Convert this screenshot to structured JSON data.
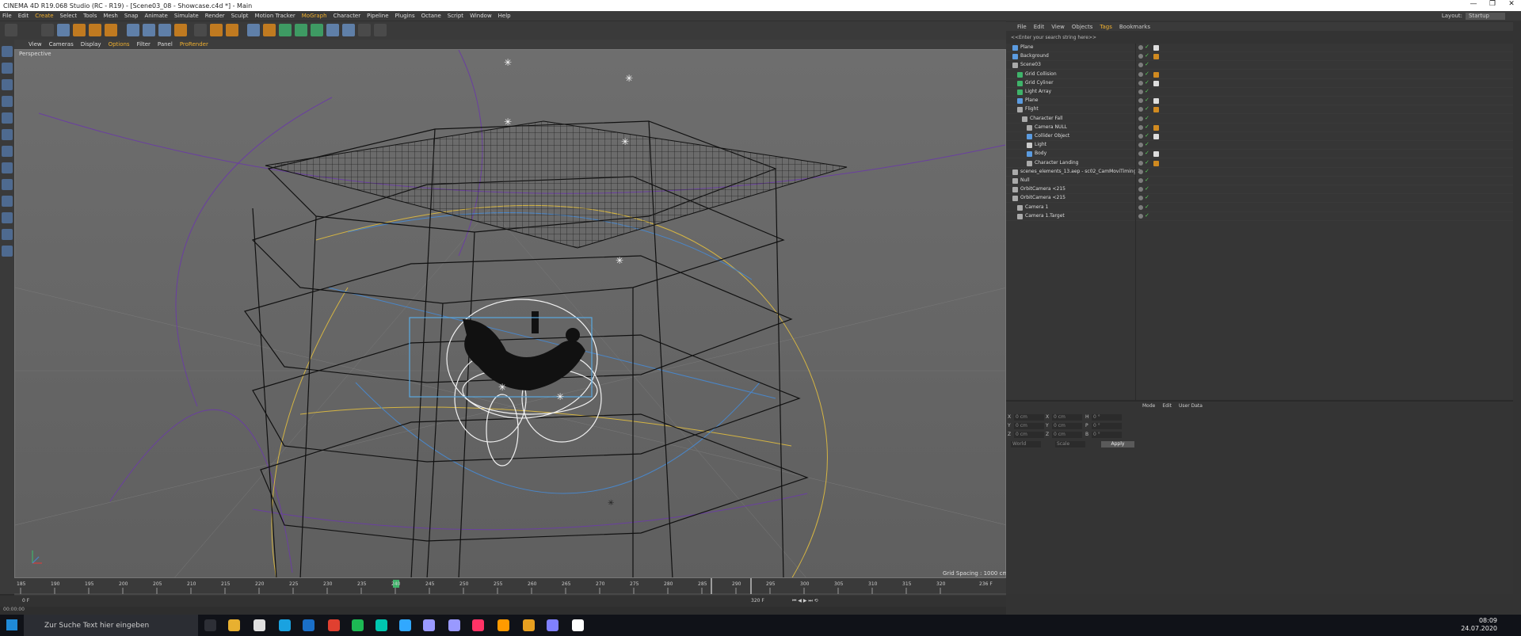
{
  "window": {
    "title": "CINEMA 4D R19.068 Studio (RC - R19) - [Scene03_08 - Showcase.c4d *] - Main",
    "controls": [
      "—",
      "❐",
      "✕"
    ]
  },
  "menu": [
    "File",
    "Edit",
    "Create",
    "Select",
    "Tools",
    "Mesh",
    "Snap",
    "Animate",
    "Simulate",
    "Render",
    "Sculpt",
    "Motion Tracker",
    "MoGraph",
    "Character",
    "Pipeline",
    "Plugins",
    "Octane",
    "Script",
    "Window",
    "Help"
  ],
  "layout": {
    "label": "Layout:",
    "value": "Startup"
  },
  "viewport": {
    "menu": [
      "View",
      "Cameras",
      "Display",
      "Options",
      "Filter",
      "Panel",
      "ProRender"
    ],
    "label": "Perspective",
    "grid_spacing": "Grid Spacing : 1000 cm"
  },
  "timeline": {
    "ticks": [
      "185",
      "190",
      "195",
      "200",
      "205",
      "210",
      "215",
      "220",
      "225",
      "230",
      "235",
      "240",
      "245",
      "250",
      "255",
      "260",
      "265",
      "270",
      "275",
      "280",
      "285",
      "290",
      "295",
      "300",
      "305",
      "310",
      "315",
      "320"
    ],
    "current": "236",
    "end_field": "236 F",
    "start_field": "0 F",
    "range_field": "320 F",
    "range_end": "320 F"
  },
  "status": {
    "time": "00:00:00"
  },
  "objects": {
    "menu": [
      "File",
      "Edit",
      "View",
      "Objects",
      "Tags",
      "Bookmarks"
    ],
    "search_placeholder": "<<Enter your search string here>>",
    "rows": [
      {
        "name": "Plane",
        "depth": 0,
        "color": "#5b9be0"
      },
      {
        "name": "Background",
        "depth": 0,
        "color": "#5b9be0"
      },
      {
        "name": "Scene03",
        "depth": 0,
        "color": "#aaaaaa"
      },
      {
        "name": "Grid Collision",
        "depth": 1,
        "color": "#3fb36a"
      },
      {
        "name": "Grid Cyliner",
        "depth": 1,
        "color": "#3fb36a"
      },
      {
        "name": "Light Array",
        "depth": 1,
        "color": "#3fb36a"
      },
      {
        "name": "Plane",
        "depth": 1,
        "color": "#5b9be0"
      },
      {
        "name": "Flight",
        "depth": 1,
        "color": "#aaaaaa"
      },
      {
        "name": "Character Fall",
        "depth": 2,
        "color": "#aaaaaa"
      },
      {
        "name": "Camera NULL",
        "depth": 3,
        "color": "#aaaaaa"
      },
      {
        "name": "Collider Object",
        "depth": 3,
        "color": "#5b9be0"
      },
      {
        "name": "Light",
        "depth": 3,
        "color": "#cccccc"
      },
      {
        "name": "Body",
        "depth": 3,
        "color": "#5b9be0"
      },
      {
        "name": "Character Landing",
        "depth": 3,
        "color": "#aaaaaa"
      },
      {
        "name": "scenes_elements_13.aep - sc02_CamMoviTiming 2",
        "depth": 0,
        "color": "#aaaaaa"
      },
      {
        "name": "Null",
        "depth": 0,
        "color": "#aaaaaa"
      },
      {
        "name": "OrbitCamera <215",
        "depth": 0,
        "color": "#aaaaaa"
      },
      {
        "name": "OrbitCamera <215",
        "depth": 0,
        "color": "#aaaaaa"
      },
      {
        "name": "Camera 1",
        "depth": 1,
        "color": "#aaaaaa"
      },
      {
        "name": "Camera 1.Target",
        "depth": 1,
        "color": "#aaaaaa"
      }
    ]
  },
  "coordinates": {
    "rows": [
      {
        "a": "X",
        "av": "0 cm",
        "b": "X",
        "bv": "0 cm",
        "c": "H",
        "cv": "0 °"
      },
      {
        "a": "Y",
        "av": "0 cm",
        "b": "Y",
        "bv": "0 cm",
        "c": "P",
        "cv": "0 °"
      },
      {
        "a": "Z",
        "av": "0 cm",
        "b": "Z",
        "bv": "0 cm",
        "c": "B",
        "cv": "0 °"
      }
    ],
    "mode1": "World",
    "mode2": "Scale",
    "apply": "Apply"
  },
  "attributes": {
    "menu": [
      "Mode",
      "Edit",
      "User Data"
    ]
  },
  "taskbar": {
    "search": "Zur Suche Text hier eingeben",
    "time": "08:09",
    "date": "24.07.2020"
  }
}
